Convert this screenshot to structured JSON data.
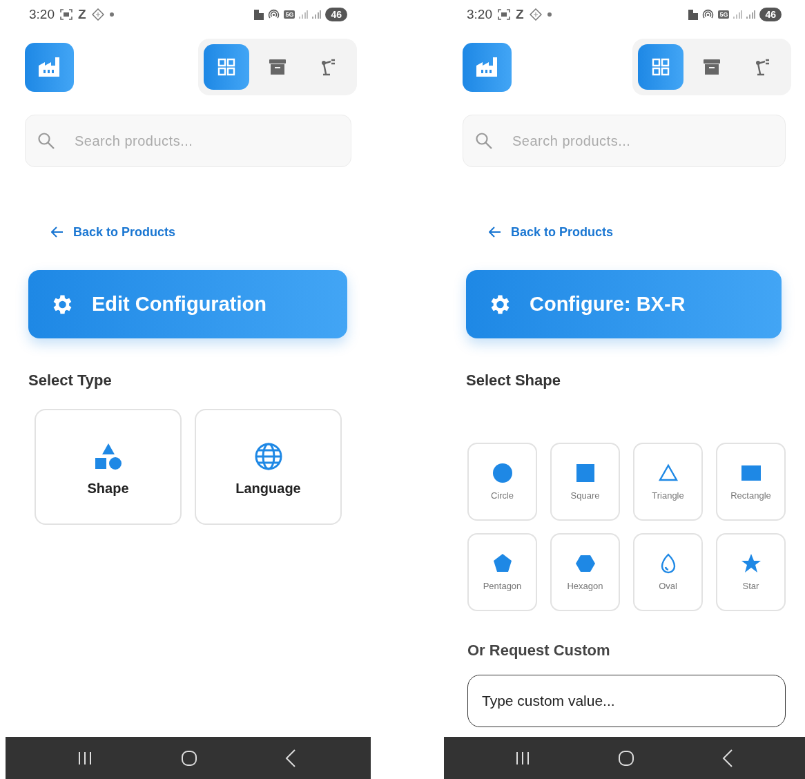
{
  "screens": [
    {
      "status_bar": {
        "time": "3:20",
        "z_label": "Z",
        "network": "5G",
        "battery": "46"
      },
      "nav_tabs": [
        {
          "kind": "grid",
          "selected": true
        },
        {
          "kind": "archive",
          "selected": false
        },
        {
          "kind": "robot",
          "selected": false
        }
      ],
      "search": {
        "placeholder": "Search products..."
      },
      "back_link": "Back to Products",
      "header": {
        "title": "Edit Configuration"
      },
      "section_title": "Select Type",
      "types": [
        {
          "kind": "shapes",
          "label": "Shape"
        },
        {
          "kind": "globe",
          "label": "Language"
        }
      ]
    },
    {
      "status_bar": {
        "time": "3:20",
        "z_label": "Z",
        "network": "5G",
        "battery": "46"
      },
      "nav_tabs": [
        {
          "kind": "grid",
          "selected": true
        },
        {
          "kind": "archive",
          "selected": false
        },
        {
          "kind": "robot",
          "selected": false
        }
      ],
      "search": {
        "placeholder": "Search products..."
      },
      "back_link": "Back to Products",
      "header": {
        "title": "Configure: BX-R"
      },
      "section_title": "Select Shape",
      "shapes": [
        {
          "kind": "circle",
          "label": "Circle"
        },
        {
          "kind": "square",
          "label": "Square"
        },
        {
          "kind": "triangle",
          "label": "Triangle"
        },
        {
          "kind": "rectangle",
          "label": "Rectangle"
        },
        {
          "kind": "pentagon",
          "label": "Pentagon"
        },
        {
          "kind": "hexagon",
          "label": "Hexagon"
        },
        {
          "kind": "oval",
          "label": "Oval"
        },
        {
          "kind": "star",
          "label": "Star"
        }
      ],
      "custom": {
        "title": "Or Request Custom",
        "placeholder": "Type custom value..."
      }
    }
  ]
}
